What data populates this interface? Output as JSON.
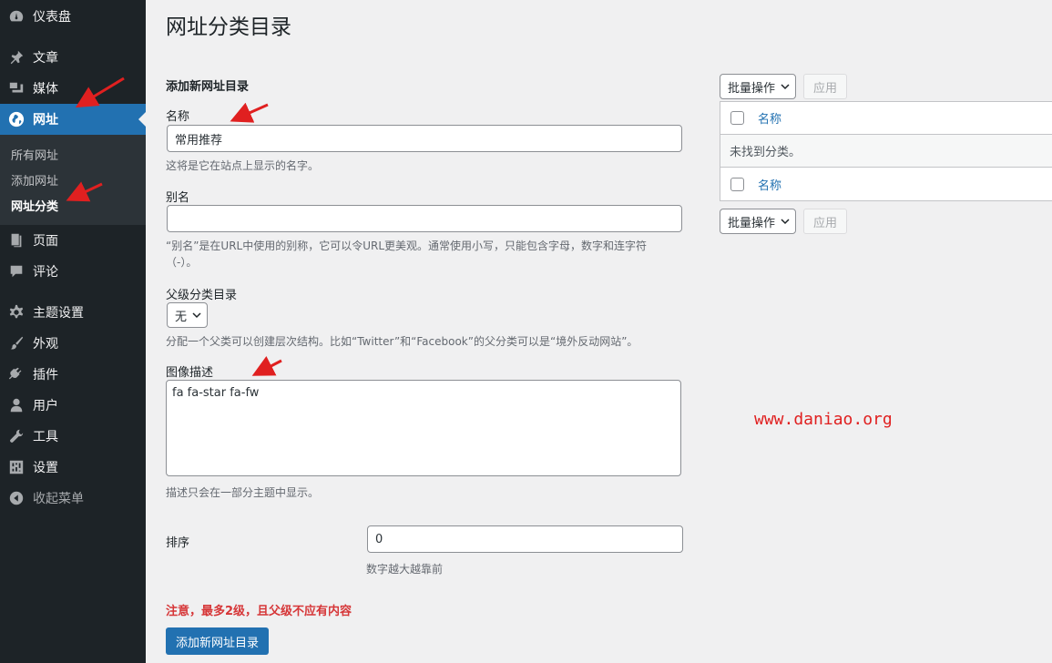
{
  "sidebar": {
    "items": [
      {
        "label": "仪表盘",
        "icon": "dashboard-icon"
      },
      {
        "label": "文章",
        "icon": "pin-icon"
      },
      {
        "label": "媒体",
        "icon": "media-icon"
      },
      {
        "label": "网址",
        "icon": "globe-icon"
      },
      {
        "label": "页面",
        "icon": "page-icon"
      },
      {
        "label": "评论",
        "icon": "comment-icon"
      },
      {
        "label": "主题设置",
        "icon": "gear-icon"
      },
      {
        "label": "外观",
        "icon": "brush-icon"
      },
      {
        "label": "插件",
        "icon": "plugin-icon"
      },
      {
        "label": "用户",
        "icon": "user-icon"
      },
      {
        "label": "工具",
        "icon": "wrench-icon"
      },
      {
        "label": "设置",
        "icon": "settings-icon"
      },
      {
        "label": "收起菜单",
        "icon": "collapse-icon"
      }
    ],
    "submenu": [
      "所有网址",
      "添加网址",
      "网址分类"
    ]
  },
  "page": {
    "title": "网址分类目录"
  },
  "form": {
    "heading": "添加新网址目录",
    "name_label": "名称",
    "name_value": "常用推荐",
    "name_help": "这将是它在站点上显示的名字。",
    "slug_label": "别名",
    "slug_value": "",
    "slug_help_1": "“别名”是在URL中使用的别称，它可以令URL更美观。通常使用小写，只能包含字母，数字和连字符",
    "slug_help_2": "（-）。",
    "parent_label": "父级分类目录",
    "parent_value": "无",
    "parent_help": "分配一个父类可以创建层次结构。比如“Twitter”和“Facebook”的父分类可以是“境外反动网站”。",
    "image_label": "图像描述",
    "image_value": "fa fa-star fa-fw",
    "image_help": "描述只会在一部分主题中显示。",
    "order_label": "排序",
    "order_value": "0",
    "order_help": "数字越大越靠前",
    "notice": "注意，最多2级，且父级不应有内容",
    "submit_label": "添加新网址目录"
  },
  "list": {
    "bulk_label": "批量操作",
    "apply_label": "应用",
    "column_name": "名称",
    "empty_text": "未找到分类。"
  },
  "watermark": "www.daniao.org",
  "colors": {
    "accent": "#2271b1",
    "sidebar": "#1d2327",
    "annotation": "#e02020"
  }
}
